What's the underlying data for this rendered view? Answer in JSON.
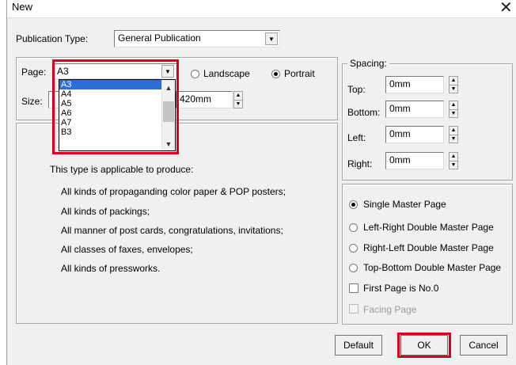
{
  "window": {
    "title": "New",
    "close_icon": "close-icon"
  },
  "publication_type": {
    "label": "Publication Type:",
    "value": "General Publication"
  },
  "page": {
    "label": "Page:",
    "value": "A3",
    "options": [
      "A3",
      "A4",
      "A5",
      "A6",
      "A7",
      "B3"
    ],
    "selected_index": 0
  },
  "size": {
    "label": "Size:",
    "height_value": "420mm"
  },
  "orientation": {
    "landscape": "Landscape",
    "portrait": "Portrait",
    "selected": "Portrait"
  },
  "spacing": {
    "legend": "Spacing:",
    "top_label": "Top:",
    "top_value": "0mm",
    "bottom_label": "Bottom:",
    "bottom_value": "0mm",
    "left_label": "Left:",
    "left_value": "0mm",
    "right_label": "Right:",
    "right_value": "0mm"
  },
  "description": {
    "intro": "This type is applicable to produce:",
    "items": [
      "All kinds of propaganding color paper & POP posters;",
      "All kinds of packings;",
      "All manner of post cards, congratulations, invitations;",
      "All classes of faxes, envelopes;",
      "All kinds of pressworks."
    ]
  },
  "master_page": {
    "options": [
      "Single Master Page",
      "Left-Right Double Master Page",
      "Right-Left Double Master Page",
      "Top-Bottom Double Master Page"
    ],
    "selected": "Single Master Page",
    "first_page_label": "First Page is No.0",
    "facing_page_label": "Facing Page"
  },
  "buttons": {
    "default": "Default",
    "ok": "OK",
    "cancel": "Cancel"
  },
  "colors": {
    "highlight_red": "#d8001f",
    "selection_blue": "#2b6fd6"
  }
}
